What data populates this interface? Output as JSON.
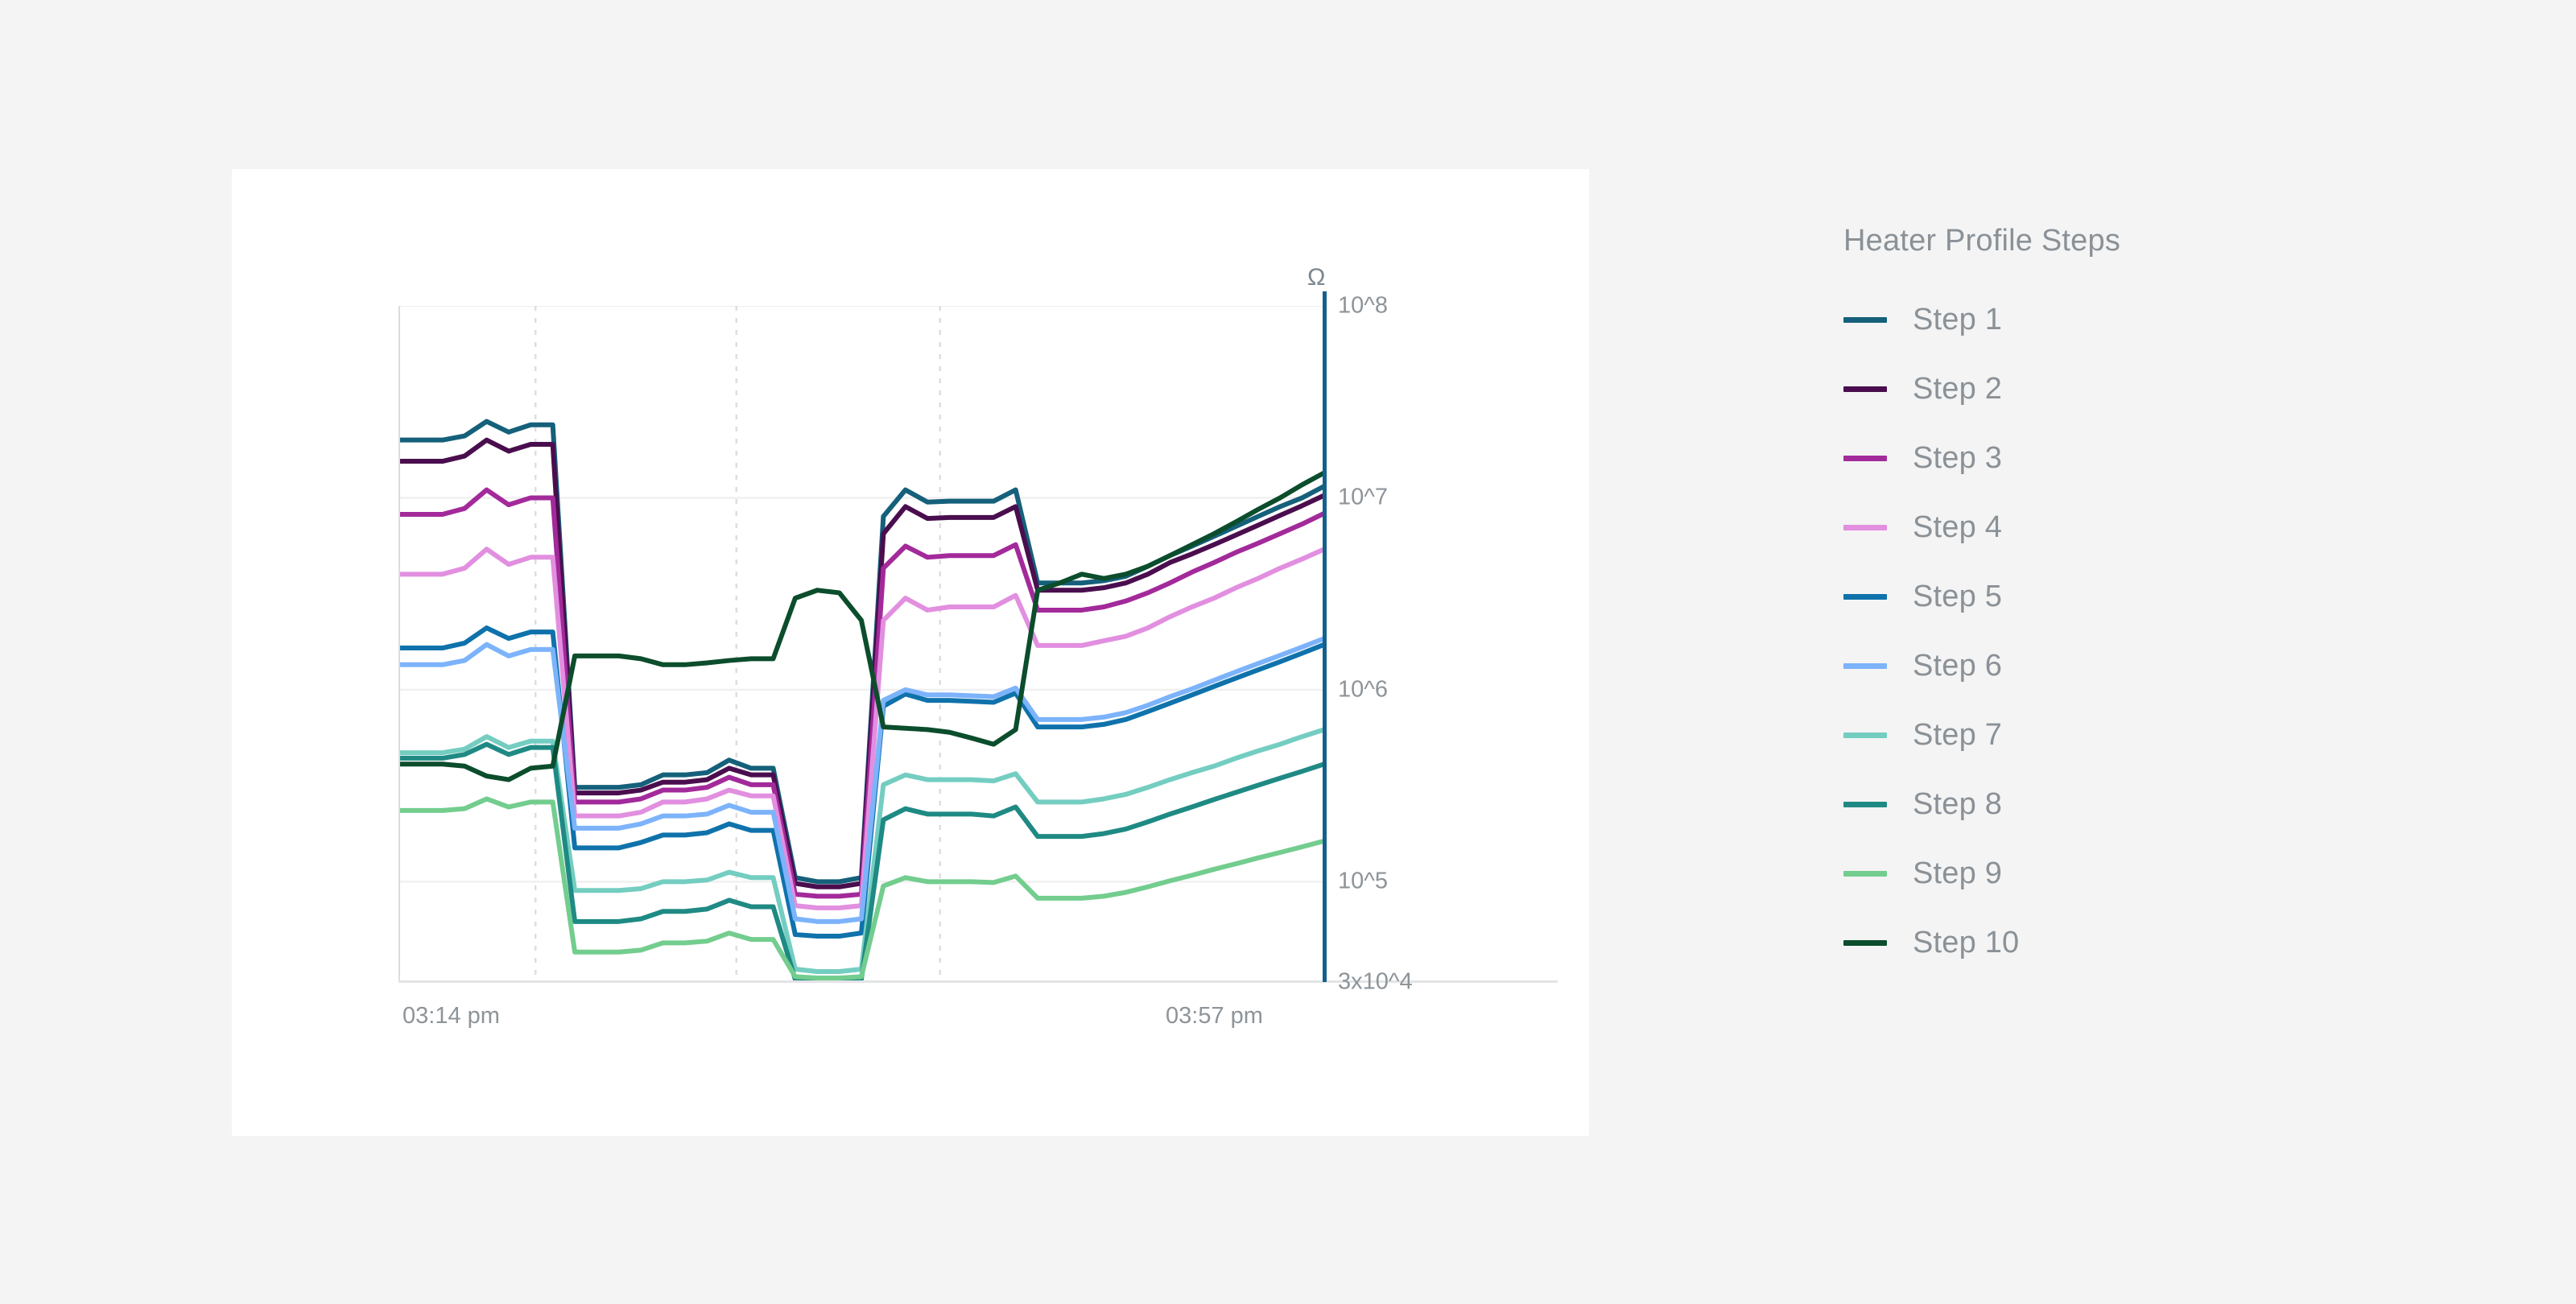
{
  "legend": {
    "title": "Heater Profile Steps",
    "items": [
      {
        "label": "Step 1",
        "color": "#15607a"
      },
      {
        "label": "Step 2",
        "color": "#4a0e4e"
      },
      {
        "label": "Step 3",
        "color": "#a32a9b"
      },
      {
        "label": "Step 4",
        "color": "#e28fe0"
      },
      {
        "label": "Step 5",
        "color": "#0f72ab"
      },
      {
        "label": "Step 6",
        "color": "#7cb3fb"
      },
      {
        "label": "Step 7",
        "color": "#74cdc1"
      },
      {
        "label": "Step 8",
        "color": "#1f8a84"
      },
      {
        "label": "Step 9",
        "color": "#73cd8e"
      },
      {
        "label": "Step 10",
        "color": "#0b4d2c"
      }
    ]
  },
  "axis": {
    "unit": "Ω",
    "y_ticks": [
      "10^8",
      "10^7",
      "10^6",
      "10^5",
      "3x10^4"
    ],
    "x_ticks": [
      "03:14 pm",
      "03:57 pm"
    ]
  },
  "chart_data": {
    "type": "line",
    "title": "Heater Profile Steps",
    "xlabel": "",
    "ylabel": "Ω",
    "yscale": "log",
    "ylim": [
      30000,
      100000000
    ],
    "ytick_values": [
      100000000,
      10000000,
      1000000,
      100000,
      30000
    ],
    "ytick_labels": [
      "10^8",
      "10^7",
      "10^6",
      "10^5",
      "3x10^4"
    ],
    "xtick_labels": [
      "03:14 pm",
      "03:57 pm"
    ],
    "x_range": [
      "03:14 pm",
      "03:57 pm"
    ],
    "grid": "both-light",
    "legend_position": "right",
    "x": [
      0,
      1,
      2,
      3,
      4,
      5,
      6,
      7,
      8,
      9,
      10,
      11,
      12,
      13,
      14,
      15,
      16,
      17,
      18,
      19,
      20,
      21,
      22,
      23,
      24,
      25,
      26,
      27,
      28,
      29,
      30,
      31,
      32,
      33,
      34,
      35,
      36,
      37,
      38,
      39,
      40,
      41,
      42
    ],
    "series": [
      {
        "name": "Step 1",
        "color": "#15607a",
        "values": [
          20000000.0,
          20000000.0,
          20000000.0,
          21000000.0,
          25000000.0,
          22000000.0,
          24000000.0,
          24000000.0,
          310000.0,
          310000.0,
          310000.0,
          320000.0,
          360000.0,
          360000.0,
          370000.0,
          430000.0,
          390000.0,
          390000.0,
          105000.0,
          100000.0,
          100000.0,
          105000.0,
          8000000.0,
          11000000.0,
          9500000.0,
          9600000.0,
          9600000.0,
          9600000.0,
          11000000.0,
          3600000.0,
          3600000.0,
          3600000.0,
          3700000.0,
          3900000.0,
          4400000.0,
          5000000.0,
          5600000.0,
          6300000.0,
          7100000.0,
          8000000.0,
          9000000.0,
          10000000.0,
          11500000.0
        ]
      },
      {
        "name": "Step 2",
        "color": "#4a0e4e",
        "values": [
          15500000.0,
          15500000.0,
          15500000.0,
          16500000.0,
          20000000.0,
          17500000.0,
          19000000.0,
          19000000.0,
          290000.0,
          290000.0,
          290000.0,
          300000.0,
          330000.0,
          330000.0,
          340000.0,
          390000.0,
          360000.0,
          360000.0,
          98000.0,
          94000.0,
          94000.0,
          98000.0,
          6500000.0,
          9000000.0,
          7800000.0,
          7900000.0,
          7900000.0,
          7900000.0,
          9000000.0,
          3300000.0,
          3300000.0,
          3300000.0,
          3400000.0,
          3600000.0,
          4000000.0,
          4600000.0,
          5100000.0,
          5700000.0,
          6400000.0,
          7200000.0,
          8100000.0,
          9100000.0,
          10300000.0
        ]
      },
      {
        "name": "Step 3",
        "color": "#a32a9b",
        "values": [
          8200000.0,
          8200000.0,
          8200000.0,
          8800000.0,
          11000000.0,
          9200000.0,
          10000000.0,
          10000000.0,
          260000.0,
          260000.0,
          260000.0,
          270000.0,
          300000.0,
          300000.0,
          310000.0,
          350000.0,
          320000.0,
          320000.0,
          86000.0,
          84000.0,
          84000.0,
          86000.0,
          4300000.0,
          5600000.0,
          4900000.0,
          5000000.0,
          5000000.0,
          5000000.0,
          5700000.0,
          2600000.0,
          2600000.0,
          2600000.0,
          2700000.0,
          2900000.0,
          3200000.0,
          3600000.0,
          4100000.0,
          4600000.0,
          5200000.0,
          5800000.0,
          6500000.0,
          7300000.0,
          8300000.0
        ]
      },
      {
        "name": "Step 4",
        "color": "#e28fe0",
        "values": [
          4000000.0,
          4000000.0,
          4000000.0,
          4300000.0,
          5400000.0,
          4500000.0,
          4900000.0,
          4900000.0,
          220000.0,
          220000.0,
          220000.0,
          230000.0,
          260000.0,
          260000.0,
          270000.0,
          300000.0,
          280000.0,
          280000.0,
          75000.0,
          73000.0,
          73000.0,
          75000.0,
          2300000.0,
          3000000.0,
          2600000.0,
          2700000.0,
          2700000.0,
          2700000.0,
          3100000.0,
          1700000.0,
          1700000.0,
          1700000.0,
          1800000.0,
          1900000.0,
          2100000.0,
          2400000.0,
          2700000.0,
          3000000.0,
          3400000.0,
          3800000.0,
          4300000.0,
          4800000.0,
          5400000.0
        ]
      },
      {
        "name": "Step 5",
        "color": "#0f72ab",
        "values": [
          1650000.0,
          1650000.0,
          1650000.0,
          1750000.0,
          2100000.0,
          1850000.0,
          2000000.0,
          2000000.0,
          150000.0,
          150000.0,
          150000.0,
          160000.0,
          175000.0,
          175000.0,
          180000.0,
          200000.0,
          185000.0,
          185000.0,
          53000.0,
          52000.0,
          52000.0,
          54000.0,
          820000.0,
          950000.0,
          880000.0,
          880000.0,
          870000.0,
          860000.0,
          960000.0,
          640000.0,
          640000.0,
          640000.0,
          660000.0,
          700000.0,
          770000.0,
          850000.0,
          940000.0,
          1040000.0,
          1150000.0,
          1270000.0,
          1400000.0,
          1550000.0,
          1720000.0
        ]
      },
      {
        "name": "Step 6",
        "color": "#7cb3fb",
        "values": [
          1350000.0,
          1350000.0,
          1350000.0,
          1420000.0,
          1720000.0,
          1500000.0,
          1620000.0,
          1620000.0,
          190000.0,
          190000.0,
          190000.0,
          200000.0,
          220000.0,
          220000.0,
          225000.0,
          250000.0,
          230000.0,
          230000.0,
          64000.0,
          62000.0,
          62000.0,
          64000.0,
          880000.0,
          1000000.0,
          940000.0,
          940000.0,
          930000.0,
          920000.0,
          1020000.0,
          700000.0,
          700000.0,
          700000.0,
          720000.0,
          760000.0,
          830000.0,
          920000.0,
          1010000.0,
          1120000.0,
          1240000.0,
          1370000.0,
          1510000.0,
          1670000.0,
          1850000.0
        ]
      },
      {
        "name": "Step 7",
        "color": "#74cdc1",
        "values": [
          470000.0,
          470000.0,
          470000.0,
          490000.0,
          570000.0,
          500000.0,
          540000.0,
          540000.0,
          90000.0,
          90000.0,
          90000.0,
          92000.0,
          100000.0,
          100000.0,
          102000.0,
          112000.0,
          105000.0,
          105000.0,
          35000.0,
          34000.0,
          34000.0,
          35000.0,
          320000.0,
          360000.0,
          340000.0,
          340000.0,
          340000.0,
          335000.0,
          365000.0,
          260000.0,
          260000.0,
          260000.0,
          270000.0,
          285000.0,
          310000.0,
          340000.0,
          370000.0,
          400000.0,
          440000.0,
          480000.0,
          520000.0,
          570000.0,
          620000.0
        ]
      },
      {
        "name": "Step 8",
        "color": "#1f8a84",
        "values": [
          440000.0,
          440000.0,
          440000.0,
          460000.0,
          520000.0,
          460000.0,
          500000.0,
          500000.0,
          62000.0,
          62000.0,
          62000.0,
          64000.0,
          70000.0,
          70000.0,
          72000.0,
          80000.0,
          74000.0,
          74000.0,
          31000.0,
          30500.0,
          30500.0,
          31000.0,
          210000.0,
          240000.0,
          225000.0,
          225000.0,
          225000.0,
          220000.0,
          245000.0,
          172000.0,
          172000.0,
          172000.0,
          178000.0,
          188000.0,
          205000.0,
          225000.0,
          245000.0,
          268000.0,
          292000.0,
          318000.0,
          346000.0,
          376000.0,
          410000.0
        ]
      },
      {
        "name": "Step 9",
        "color": "#73cd8e",
        "values": [
          235000.0,
          235000.0,
          235000.0,
          240000.0,
          270000.0,
          245000.0,
          260000.0,
          260000.0,
          43000.0,
          43000.0,
          43000.0,
          44000.0,
          48000.0,
          48000.0,
          49000.0,
          54000.0,
          50000.0,
          50000.0,
          32000.0,
          31500.0,
          31500.0,
          32000.0,
          95000.0,
          105000.0,
          100000.0,
          100000.0,
          100000.0,
          99000.0,
          107000.0,
          82000.0,
          82000.0,
          82000.0,
          84000.0,
          88000.0,
          94000.0,
          101000.0,
          108000.0,
          116000.0,
          124000.0,
          133000.0,
          142000.0,
          152000.0,
          163000.0
        ]
      },
      {
        "name": "Step 10",
        "color": "#0b4d2c",
        "values": [
          410000.0,
          410000.0,
          410000.0,
          400000.0,
          355000.0,
          340000.0,
          390000.0,
          400000.0,
          1500000.0,
          1500000.0,
          1500000.0,
          1450000.0,
          1350000.0,
          1350000.0,
          1380000.0,
          1420000.0,
          1450000.0,
          1450000.0,
          3000000.0,
          3300000.0,
          3200000.0,
          2300000.0,
          640000.0,
          630000.0,
          620000.0,
          600000.0,
          560000.0,
          520000.0,
          620000.0,
          3300000.0,
          3600000.0,
          4000000.0,
          3800000.0,
          4000000.0,
          4400000.0,
          5000000.0,
          5700000.0,
          6500000.0,
          7500000.0,
          8700000.0,
          10000000.0,
          11700000.0,
          13500000.0
        ]
      }
    ]
  }
}
